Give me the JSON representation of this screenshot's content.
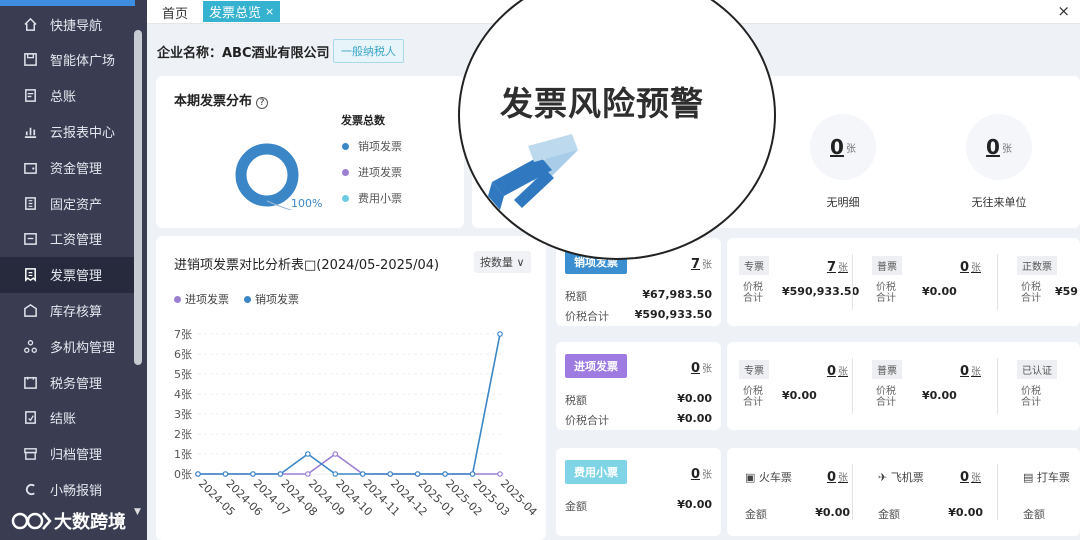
{
  "sidebar": {
    "items": [
      {
        "label": "快捷导航",
        "icon": "home-icon"
      },
      {
        "label": "智能体广场",
        "icon": "save-icon"
      },
      {
        "label": "总账",
        "icon": "ledger-icon"
      },
      {
        "label": "云报表中心",
        "icon": "chart-icon"
      },
      {
        "label": "资金管理",
        "icon": "wallet-icon"
      },
      {
        "label": "固定资产",
        "icon": "building-icon"
      },
      {
        "label": "工资管理",
        "icon": "payroll-icon"
      },
      {
        "label": "发票管理",
        "icon": "invoice-icon"
      },
      {
        "label": "库存核算",
        "icon": "inventory-icon"
      },
      {
        "label": "多机构管理",
        "icon": "org-icon"
      },
      {
        "label": "税务管理",
        "icon": "tax-icon"
      },
      {
        "label": "结账",
        "icon": "closing-icon"
      },
      {
        "label": "归档管理",
        "icon": "archive-icon"
      },
      {
        "label": "小畅报销",
        "icon": "reimburse-icon"
      }
    ],
    "active_index": 7,
    "brand": "大数跨境"
  },
  "tabs": {
    "home": "首页",
    "active": "发票总览",
    "close": "×"
  },
  "window": {
    "close": "×"
  },
  "company": {
    "name": "企业名称：ABC酒业有限公司",
    "taxpayer_type": "一般纳税人"
  },
  "distribution": {
    "title": "本期发票分布",
    "legend_title": "发票总数",
    "legend": [
      {
        "label": "销项发票",
        "color": "#3b86c6"
      },
      {
        "label": "进项发票",
        "color": "#9b7fd3"
      },
      {
        "label": "费用小票",
        "color": "#6fcde0"
      }
    ],
    "percent": "100%"
  },
  "warning": {
    "title": "发票风险预警",
    "stats": [
      {
        "value": "0",
        "unit": "张",
        "label": "无明细"
      },
      {
        "value": "0",
        "unit": "张",
        "label": "无往来单位"
      }
    ]
  },
  "chart_card": {
    "title": "进销项发票对比分析表□(2024/05-2025/04)",
    "selector": "按数量",
    "chevron": "∨"
  },
  "chart_data": {
    "type": "line",
    "categories": [
      "2024-05",
      "2024-06",
      "2024-07",
      "2024-08",
      "2024-09",
      "2024-10",
      "2024-11",
      "2024-12",
      "2025-01",
      "2025-02",
      "2025-03",
      "2025-04"
    ],
    "series": [
      {
        "name": "进项发票",
        "color": "#9b7fd3",
        "values": [
          0,
          0,
          0,
          0,
          0,
          1,
          0,
          0,
          0,
          0,
          0,
          0
        ]
      },
      {
        "name": "销项发票",
        "color": "#3b86c6",
        "values": [
          0,
          0,
          0,
          0,
          1,
          0,
          0,
          0,
          0,
          0,
          0,
          7
        ]
      }
    ],
    "y_ticks": [
      "0张",
      "1张",
      "2张",
      "3张",
      "4张",
      "5张",
      "6张",
      "7张"
    ],
    "ylim": [
      0,
      7
    ]
  },
  "invoices": [
    {
      "tag": "销项发票",
      "tag_color": "#3b8fd0",
      "count": "7",
      "unit": "张",
      "rows": [
        {
          "label": "税额",
          "value": "¥67,983.50"
        },
        {
          "label": "价税合计",
          "value": "¥590,933.50"
        }
      ],
      "details": [
        {
          "tag": "专票",
          "count": "7",
          "unit": "张",
          "label": "价税合计",
          "amount": "¥590,933.50"
        },
        {
          "tag": "普票",
          "count": "0",
          "unit": "张",
          "label": "价税合计",
          "amount": "¥0.00"
        },
        {
          "tag": "正数票",
          "count": "",
          "unit": "",
          "label": "价税合计",
          "amount": "¥59"
        }
      ]
    },
    {
      "tag": "进项发票",
      "tag_color": "#9e7be0",
      "count": "0",
      "unit": "张",
      "rows": [
        {
          "label": "税额",
          "value": "¥0.00"
        },
        {
          "label": "价税合计",
          "value": "¥0.00"
        }
      ],
      "details": [
        {
          "tag": "专票",
          "count": "0",
          "unit": "张",
          "label": "价税合计",
          "amount": "¥0.00"
        },
        {
          "tag": "普票",
          "count": "0",
          "unit": "张",
          "label": "价税合计",
          "amount": "¥0.00"
        },
        {
          "tag": "已认证",
          "count": "",
          "unit": "",
          "label": "价税合计",
          "amount": ""
        }
      ]
    },
    {
      "tag": "费用小票",
      "tag_color": "#7fd4e6",
      "count": "0",
      "unit": "张",
      "rows": [
        {
          "label": "金额",
          "value": "¥0.00"
        }
      ],
      "details": [
        {
          "tag": "火车票",
          "icon": "train-icon",
          "glyph": "▣",
          "count": "0",
          "unit": "张",
          "label": "金额",
          "amount": "¥0.00"
        },
        {
          "tag": "飞机票",
          "icon": "plane-icon",
          "glyph": "✈",
          "count": "0",
          "unit": "张",
          "label": "金额",
          "amount": "¥0.00"
        },
        {
          "tag": "打车票",
          "icon": "taxi-icon",
          "glyph": "▤",
          "count": "",
          "unit": "",
          "label": "金额",
          "amount": ""
        }
      ]
    }
  ]
}
